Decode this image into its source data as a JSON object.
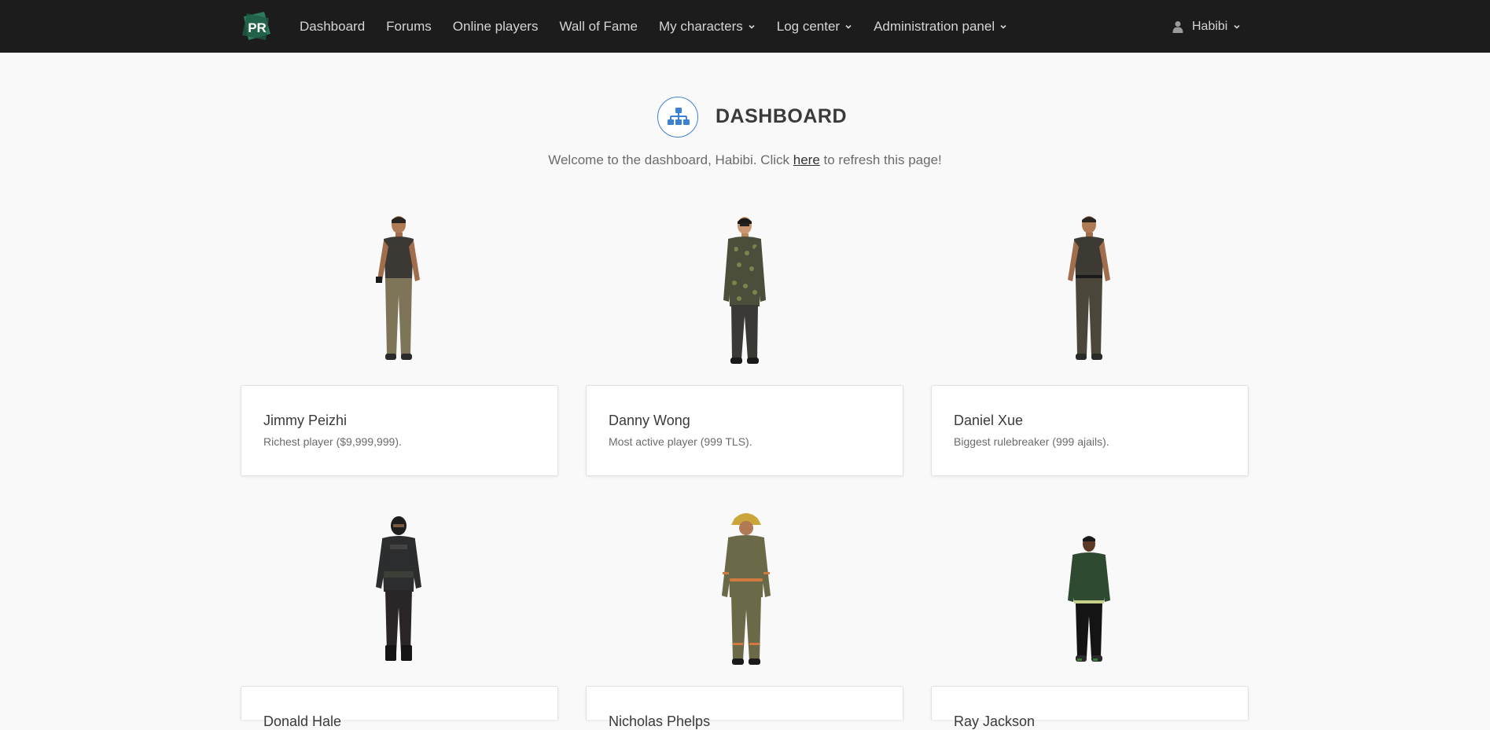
{
  "nav": {
    "items": [
      {
        "label": "Dashboard",
        "dropdown": false
      },
      {
        "label": "Forums",
        "dropdown": false
      },
      {
        "label": "Online players",
        "dropdown": false
      },
      {
        "label": "Wall of Fame",
        "dropdown": false
      },
      {
        "label": "My characters",
        "dropdown": true
      },
      {
        "label": "Log center",
        "dropdown": true
      },
      {
        "label": "Administration panel",
        "dropdown": true
      }
    ],
    "user": "Habibi"
  },
  "header": {
    "title": "DASHBOARD",
    "welcome_before": "Welcome to the dashboard, Habibi. Click ",
    "welcome_link": "here",
    "welcome_after": " to refresh this page!"
  },
  "cards": [
    {
      "name": "Jimmy Peizhi",
      "desc": "Richest player ($9,999,999)."
    },
    {
      "name": "Danny Wong",
      "desc": "Most active player (999 TLS)."
    },
    {
      "name": "Daniel Xue",
      "desc": "Biggest rulebreaker (999 ajails)."
    },
    {
      "name": "Donald Hale",
      "desc": ""
    },
    {
      "name": "Nicholas Phelps",
      "desc": ""
    },
    {
      "name": "Ray Jackson",
      "desc": ""
    }
  ],
  "colors": {
    "navbar": "#1c1c1c",
    "accent": "#3b82d6",
    "background": "#f9f9f9"
  }
}
